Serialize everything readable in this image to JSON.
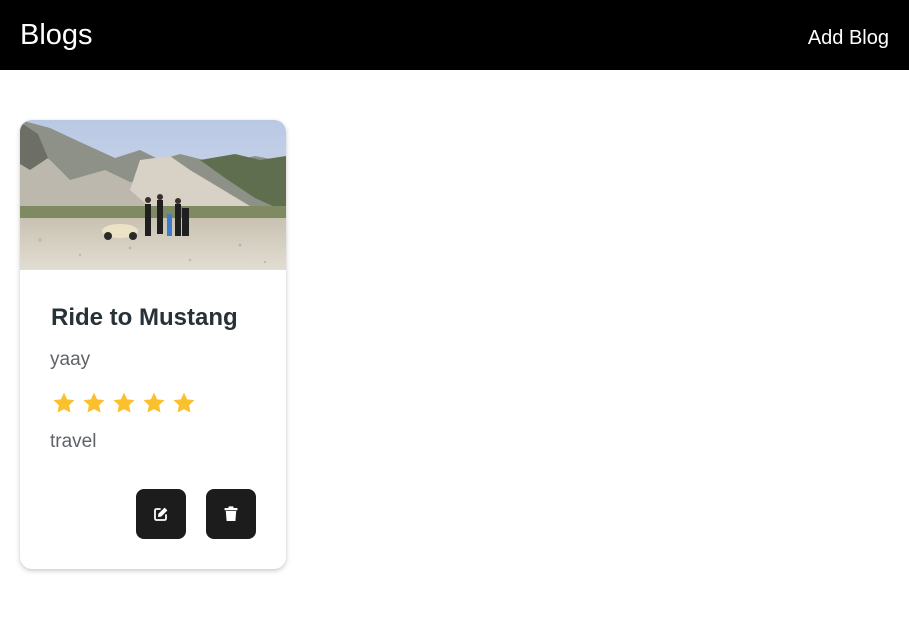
{
  "header": {
    "title": "Blogs",
    "add_label": "Add Blog"
  },
  "posts": [
    {
      "title": "Ride to Mustang",
      "description": "yaay",
      "rating": 5,
      "rating_max": 5,
      "category": "travel"
    }
  ],
  "icons": {
    "edit": "edit-icon",
    "delete": "trash-icon",
    "star": "star-icon"
  },
  "colors": {
    "header_bg": "#000000",
    "star": "#fbc02d",
    "button_bg": "#1c1c1c",
    "title_text": "#263238"
  }
}
